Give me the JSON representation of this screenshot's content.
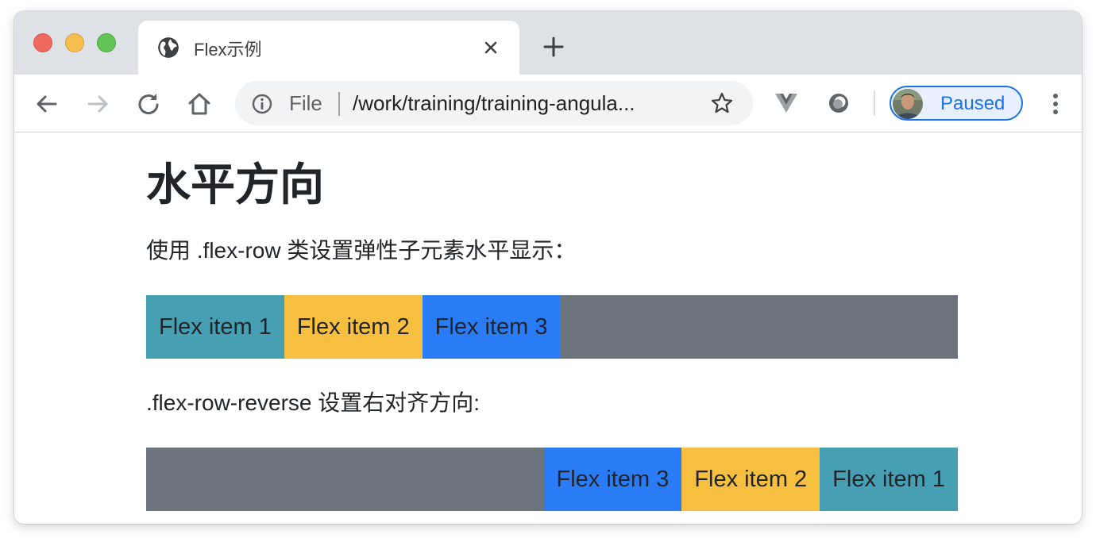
{
  "browser": {
    "tab": {
      "title": "Flex示例",
      "favicon": "globe-icon"
    },
    "toolbar": {
      "address": {
        "scheme_label": "File",
        "url_display": "/work/training/training-angula..."
      },
      "profile_status": "Paused"
    },
    "colors": {
      "tabstrip": "#dee1e6",
      "accent": "#1a73e8",
      "omnibox": "#f1f3f4"
    }
  },
  "page": {
    "heading": "水平方向",
    "row_description": "使用 .flex-row 类设置弹性子元素水平显示：",
    "reverse_description": ".flex-row-reverse 设置右对齐方向:",
    "row_items": [
      {
        "label": "Flex item 1",
        "variant": "info",
        "color": "#479fb3"
      },
      {
        "label": "Flex item 2",
        "variant": "warning",
        "color": "#f6bf40"
      },
      {
        "label": "Flex item 3",
        "variant": "primary",
        "color": "#2a7bf6"
      }
    ],
    "reverse_items": [
      {
        "label": "Flex item 1",
        "variant": "info",
        "color": "#479fb3"
      },
      {
        "label": "Flex item 2",
        "variant": "warning",
        "color": "#f6bf40"
      },
      {
        "label": "Flex item 3",
        "variant": "primary",
        "color": "#2a7bf6"
      }
    ],
    "container_color": "#6c757d"
  }
}
